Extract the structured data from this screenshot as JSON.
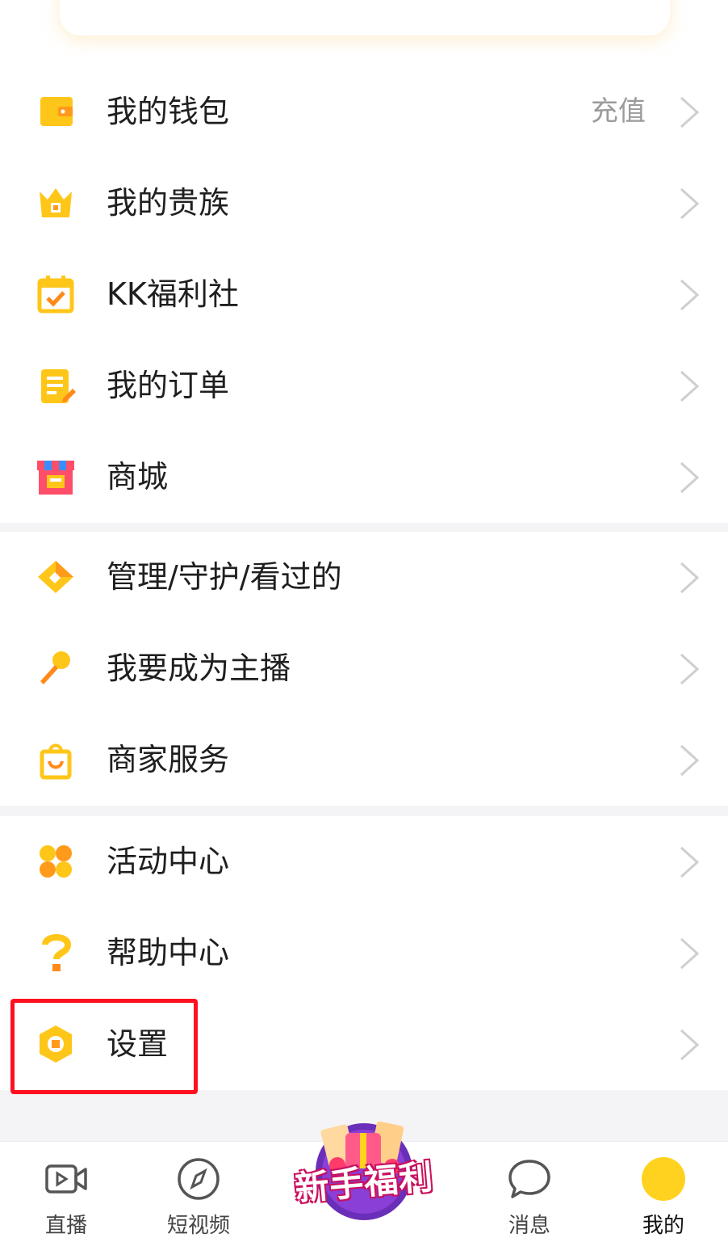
{
  "menu": {
    "group1": [
      {
        "label": "我的钱包",
        "extra": "充值",
        "icon": "wallet-icon"
      },
      {
        "label": "我的贵族",
        "icon": "crown-icon"
      },
      {
        "label": "KK福利社",
        "icon": "calendar-check-icon"
      },
      {
        "label": "我的订单",
        "icon": "order-note-icon"
      },
      {
        "label": "商城",
        "icon": "store-icon"
      }
    ],
    "group2": [
      {
        "label": "管理/守护/看过的",
        "icon": "diamond-icon"
      },
      {
        "label": "我要成为主播",
        "icon": "microphone-icon"
      },
      {
        "label": "商家服务",
        "icon": "shopping-bag-icon"
      }
    ],
    "group3": [
      {
        "label": "活动中心",
        "icon": "clover-icon"
      },
      {
        "label": "帮助中心",
        "icon": "question-icon"
      },
      {
        "label": "设置",
        "icon": "settings-hexagon-icon"
      }
    ]
  },
  "tabbar": {
    "tabs": [
      {
        "label": "直播",
        "icon": "video-camera-icon"
      },
      {
        "label": "短视频",
        "icon": "compass-icon"
      },
      {
        "label": "消息",
        "icon": "chat-bubble-icon"
      },
      {
        "label": "我的",
        "icon": "avatar-icon"
      }
    ],
    "promo": {
      "label": "新手福利",
      "icon": "gift-promo-icon"
    }
  },
  "colors": {
    "accent_yellow": "#ffc61a",
    "accent_orange": "#ff9a1a",
    "highlight_red": "#ff1020",
    "text_primary": "#1f1f1f",
    "text_secondary": "#9b9b9b"
  }
}
